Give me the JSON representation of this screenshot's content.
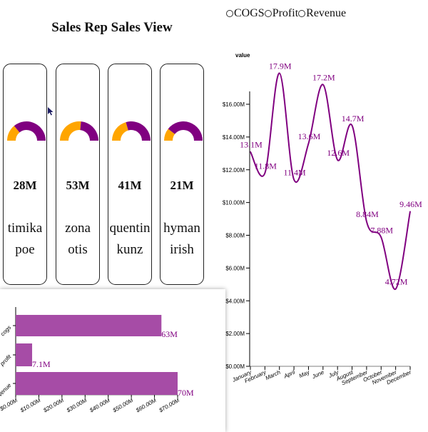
{
  "title": "Sales Rep Sales View",
  "colors": {
    "purple": "#800080",
    "orange": "#ffa500",
    "bar": "#a64ca6",
    "bar_label": "#800080"
  },
  "reps": [
    {
      "value_label": "28M",
      "name": "timika poe",
      "fraction": 0.28
    },
    {
      "value_label": "53M",
      "name": "zona otis",
      "fraction": 0.53
    },
    {
      "value_label": "41M",
      "name": "quentin kunz",
      "fraction": 0.41
    },
    {
      "value_label": "21M",
      "name": "hyman irish",
      "fraction": 0.21
    }
  ],
  "legend": [
    "COGS",
    "Profit",
    "Revenue"
  ],
  "chart_data": [
    {
      "type": "bar",
      "orientation": "horizontal",
      "categories": [
        "cogs",
        "profit",
        "revenue"
      ],
      "values": [
        63,
        7.1,
        70
      ],
      "value_labels": [
        "63M",
        "7.1M",
        "70M"
      ],
      "xticks": [
        "$0.00M",
        "$10.00M",
        "$20.00M",
        "$30.00M",
        "$40.00M",
        "$50.00M",
        "$60.00M",
        "$70.00M"
      ],
      "xlim": [
        0,
        70
      ]
    },
    {
      "type": "line",
      "ylabel": "value",
      "categories": [
        "January",
        "February",
        "March",
        "April",
        "May",
        "June",
        "July",
        "August",
        "September",
        "October",
        "November",
        "December"
      ],
      "values": [
        13.1,
        11.8,
        17.9,
        11.4,
        13.6,
        17.2,
        12.6,
        14.7,
        8.84,
        7.88,
        4.72,
        9.46
      ],
      "value_labels": [
        "13.1M",
        "11.8M",
        "17.9M",
        "11.4M",
        "13.6M",
        "17.2M",
        "12.6M",
        "14.7M",
        "8.84M",
        "7.88M",
        "4.72M",
        "9.46M"
      ],
      "yticks": [
        "$0.00M",
        "$2.00M",
        "$4.00M",
        "$6.00M",
        "$8.00M",
        "$10.00M",
        "$12.00M",
        "$14.00M",
        "$16.00M"
      ],
      "ylim": [
        0,
        16
      ],
      "grid": false
    }
  ]
}
